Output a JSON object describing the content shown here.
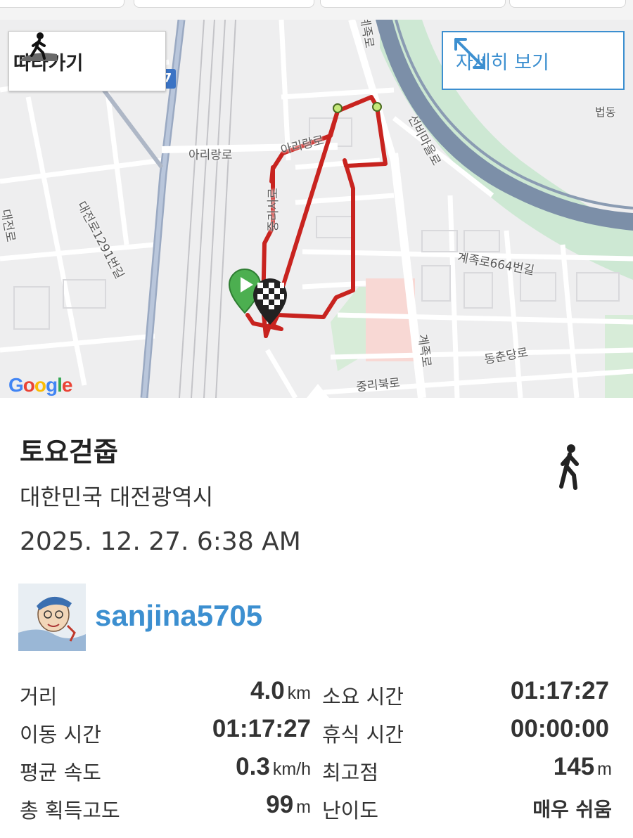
{
  "map": {
    "follow_button": "따라가기",
    "detail_button": "자세히 보기",
    "route_number": "7",
    "google_logo": [
      "G",
      "o",
      "o",
      "g",
      "l",
      "e"
    ],
    "google_colors": [
      "#4285F4",
      "#EA4335",
      "#FBBC05",
      "#4285F4",
      "#34A853",
      "#EA4335"
    ],
    "labels": {
      "arirang_ro": "아리랑로",
      "arirang_ro_2": "아리랑로",
      "daejeon_ro_1291": "대전로1291번길",
      "daejeon_ro_edge": "대전로",
      "jungni_seo_ro": "중리서로",
      "seonbi_maeul_ro": "선비마을로",
      "beop_dong": "법동",
      "gyejok_ro_664": "계족로664번길",
      "gyejok_ro": "계족로",
      "dongchun_dang_ro": "동춘당로",
      "jungni_buk_ro": "중리북로",
      "top_road": "계족로"
    },
    "colors": {
      "route": "#c8231f",
      "start": "#4caf50",
      "accent": "#3c8fd0"
    }
  },
  "activity": {
    "title": "토요걷줍",
    "location": "대한민국 대전광역시",
    "datetime": "2025. 12. 27. 6:38 AM",
    "type_icon": "walking-person-icon",
    "username": "sanjina5705"
  },
  "stats": {
    "distance": {
      "label": "거리",
      "value": "4.0",
      "unit": "km"
    },
    "duration": {
      "label": "소요 시간",
      "value": "01:17:27"
    },
    "moving_time": {
      "label": "이동 시간",
      "value": "01:17:27"
    },
    "rest_time": {
      "label": "휴식 시간",
      "value": "00:00:00"
    },
    "avg_speed": {
      "label": "평균 속도",
      "value": "0.3",
      "unit": "km/h"
    },
    "max_elevation": {
      "label": "최고점",
      "value": "145",
      "unit": "m"
    },
    "total_ascent": {
      "label": "총 획득고도",
      "value": "99",
      "unit": "m"
    },
    "difficulty": {
      "label": "난이도",
      "value": "매우 쉬움"
    }
  }
}
